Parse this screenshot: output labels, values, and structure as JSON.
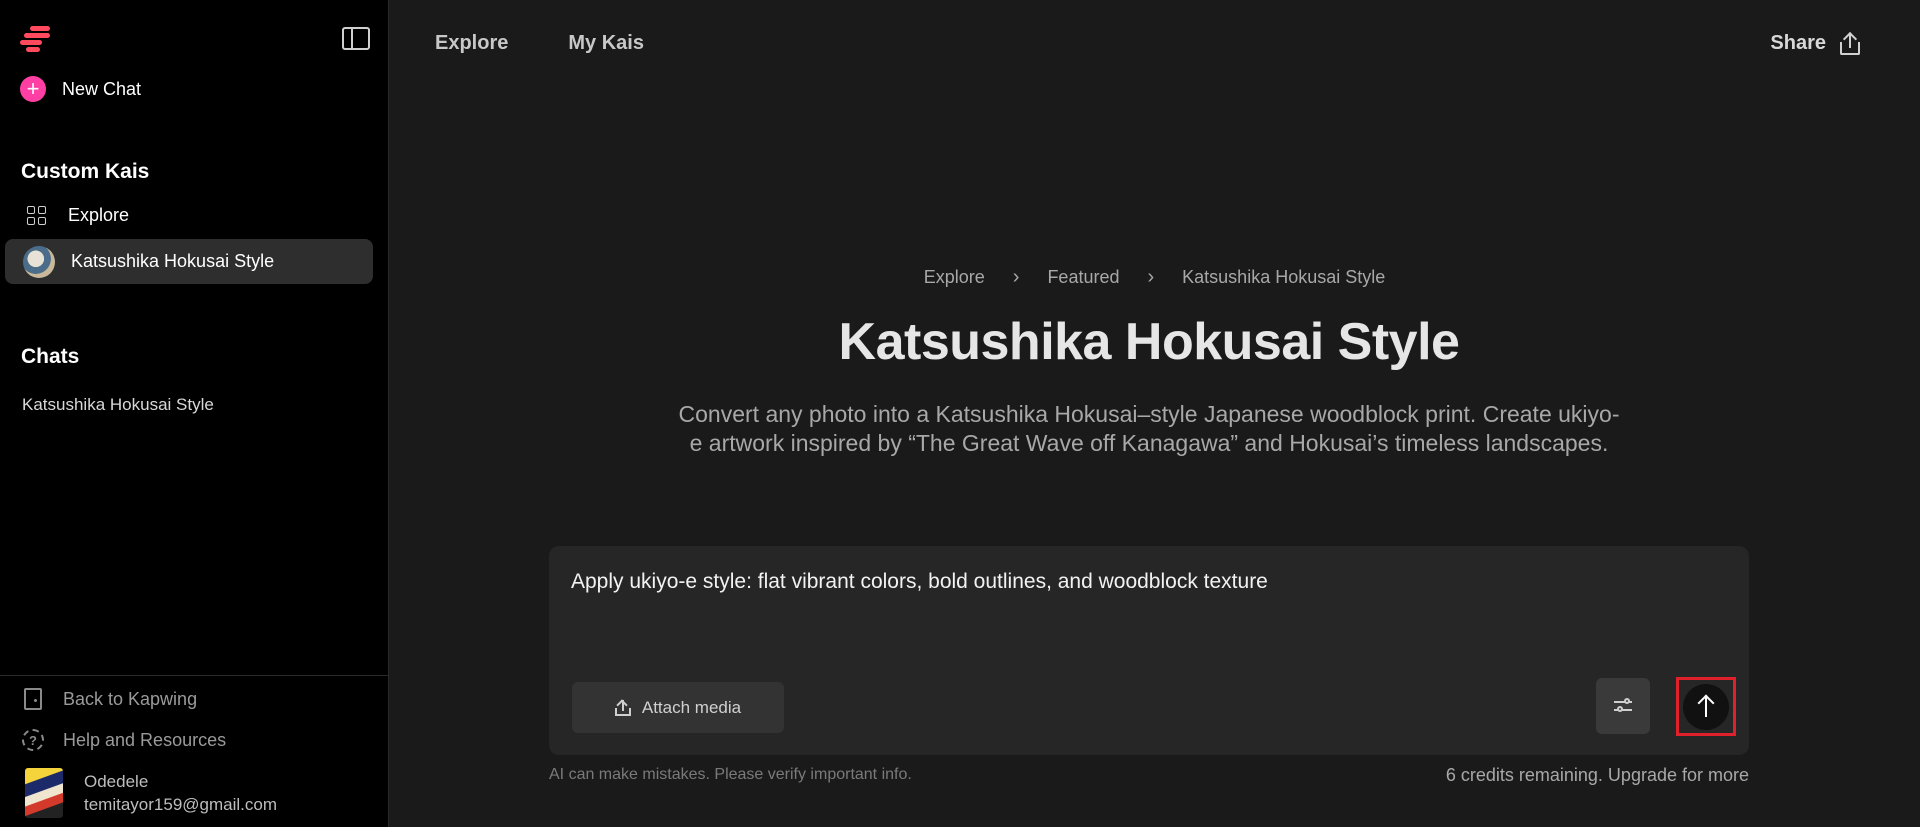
{
  "sidebar": {
    "new_chat_label": "New Chat",
    "custom_kais_title": "Custom Kais",
    "custom_kais": [
      {
        "label": "Explore",
        "icon": "grid-icon",
        "active": false
      },
      {
        "label": "Katsushika Hokusai Style",
        "icon": "hokusai-avatar",
        "active": true
      }
    ],
    "chats_title": "Chats",
    "chats": [
      {
        "label": "Katsushika Hokusai Style"
      }
    ],
    "bottom_links": [
      {
        "label": "Back to Kapwing",
        "icon": "door-icon"
      },
      {
        "label": "Help and Resources",
        "icon": "help-circle-icon"
      }
    ],
    "user": {
      "name": "Odedele",
      "email": "temitayor159@gmail.com"
    }
  },
  "header": {
    "nav": [
      {
        "label": "Explore"
      },
      {
        "label": "My Kais"
      }
    ],
    "share_label": "Share"
  },
  "main": {
    "breadcrumb": [
      "Explore",
      "Featured",
      "Katsushika Hokusai Style"
    ],
    "title": "Katsushika Hokusai Style",
    "description": "Convert any photo into a Katsushika Hokusai–style Japanese woodblock print. Create ukiyo-e artwork inspired by “The Great Wave off Kanagawa” and Hokusai’s timeless landscapes.",
    "composer": {
      "prompt": "Apply ukiyo-e style: flat vibrant colors, bold outlines, and woodblock texture",
      "attach_label": "Attach media"
    },
    "disclaimer": "AI can make mistakes. Please verify important info.",
    "credits": "6 credits remaining. Upgrade for more"
  },
  "colors": {
    "brand": "#ff4a5e",
    "new_chat_accent": "#ff3fa4",
    "highlight_frame": "#e0202a"
  }
}
